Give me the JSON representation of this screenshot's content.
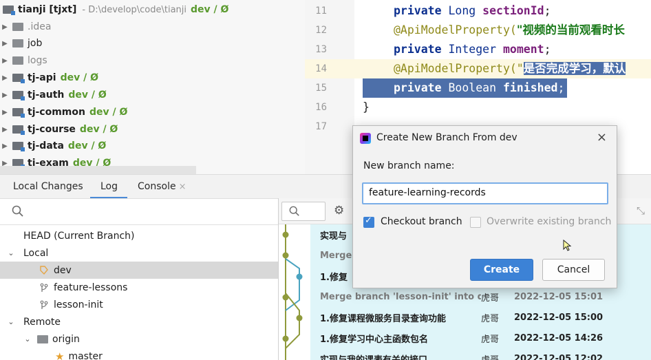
{
  "project_tree": {
    "root": {
      "name": "tianji [tjxt]",
      "path": "- D:\\develop\\code\\tianji",
      "vcs": "dev / Ø"
    },
    "items": [
      {
        "name": ".idea",
        "vcs": ""
      },
      {
        "name": "job",
        "vcs": ""
      },
      {
        "name": "logs",
        "vcs": ""
      },
      {
        "name": "tj-api",
        "vcs": "dev / Ø"
      },
      {
        "name": "tj-auth",
        "vcs": "dev / Ø"
      },
      {
        "name": "tj-common",
        "vcs": "dev / Ø"
      },
      {
        "name": "tj-course",
        "vcs": "dev / Ø"
      },
      {
        "name": "tj-data",
        "vcs": "dev / Ø"
      },
      {
        "name": "tj-exam",
        "vcs": "dev / Ø"
      }
    ]
  },
  "editor": {
    "line_numbers": [
      "11",
      "12",
      "13",
      "14",
      "15",
      "16",
      "17"
    ],
    "line11": {
      "kw": "private",
      "type": "Long",
      "field": "sectionId",
      "end": ";"
    },
    "line12": {
      "ann": "@ApiModelProperty(",
      "str": "\"视频的当前观看时长"
    },
    "line13": {
      "kw": "private",
      "type": "Integer",
      "field": "moment",
      "end": ";"
    },
    "line14": {
      "ann": "@ApiModelProperty(\"",
      "str": "是否完成学习，默认"
    },
    "line15": {
      "kw": "private",
      "type": "Boolean",
      "field": "finished",
      "end": ";"
    },
    "line16": "}"
  },
  "tool_tabs": [
    {
      "label": "Local Changes"
    },
    {
      "label": "Log"
    },
    {
      "label": "Console",
      "close": "×"
    }
  ],
  "branches": {
    "head": "HEAD (Current Branch)",
    "local_label": "Local",
    "local": [
      "dev",
      "feature-lessons",
      "lesson-init"
    ],
    "remote_label": "Remote",
    "remote_group": "origin",
    "remote": [
      "master"
    ]
  },
  "log": {
    "rows": [
      {
        "msg": "实现与",
        "author": "",
        "date": ""
      },
      {
        "msg": "Merge",
        "author": "",
        "date": ""
      },
      {
        "msg": "1.修复",
        "author": "",
        "date": ""
      },
      {
        "msg": "Merge branch 'lesson-init' into dev",
        "author": "虎哥",
        "date": "2022-12-05 15:01",
        "merge": true
      },
      {
        "msg": "1.修复课程微服务目录查询功能",
        "author": "虎哥",
        "date": "2022-12-05 15:00"
      },
      {
        "msg": "1.修复学习中心主函数包名",
        "author": "虎哥",
        "date": "2022-12-05 14:26"
      },
      {
        "msg": "实现与我的课表有关的接口",
        "author": "虎哥",
        "date": "2022-12-05 12:02"
      }
    ]
  },
  "dialog": {
    "title": "Create New Branch From dev",
    "close": "×",
    "label": "New branch name:",
    "input_value": "feature-learning-records",
    "checkout_label": "Checkout branch",
    "checkout_checked": true,
    "overwrite_label": "Overwrite existing branch",
    "overwrite_checked": false,
    "create_label": "Create",
    "cancel_label": "Cancel"
  },
  "colors": {
    "accent": "#3c82d6",
    "vcs_green": "#5a9a2e",
    "selection": "#4d6fa9",
    "log_highlight": "#dff5f9"
  }
}
